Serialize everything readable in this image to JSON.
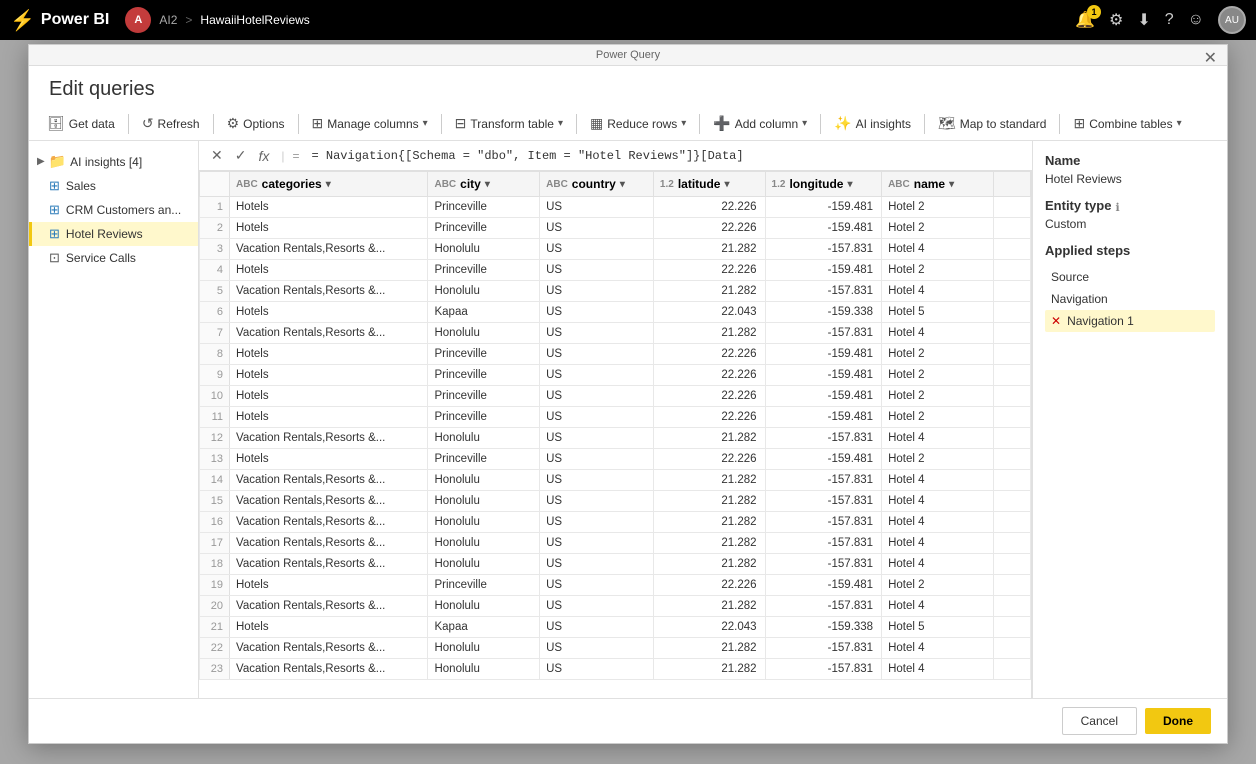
{
  "topbar": {
    "brand": "Power BI",
    "brand_icon": "⚡",
    "user_initials": "A",
    "ai2_label": "AI2",
    "breadcrumb_sep": ">",
    "breadcrumb_item": "HawaiiHotelReviews",
    "notification_count": "1",
    "icons": {
      "notification": "🔔",
      "settings": "⚙",
      "download": "⬇",
      "help": "?",
      "smiley": "☺"
    }
  },
  "modal": {
    "header_label": "Power Query",
    "page_title": "Edit queries",
    "close_icon": "✕"
  },
  "toolbar": {
    "get_data": "Get data",
    "refresh": "Refresh",
    "options": "Options",
    "manage_columns": "Manage columns",
    "transform_table": "Transform table",
    "reduce_rows": "Reduce rows",
    "add_column": "Add column",
    "ai_insights": "AI insights",
    "map_to_standard": "Map to standard",
    "combine_tables": "Combine tables"
  },
  "sidebar": {
    "group_label": "AI insights [4]",
    "items": [
      {
        "label": "Sales",
        "type": "table"
      },
      {
        "label": "CRM Customers an...",
        "type": "table"
      },
      {
        "label": "Hotel Reviews",
        "type": "table",
        "active": true
      },
      {
        "label": "Service Calls",
        "type": "service"
      }
    ]
  },
  "formula_bar": {
    "formula": "= Navigation{[Schema = \"dbo\", Item = \"Hotel Reviews\"]}[Data]"
  },
  "columns": [
    {
      "name": "categories",
      "type": "ABC"
    },
    {
      "name": "city",
      "type": "ABC"
    },
    {
      "name": "country",
      "type": "ABC"
    },
    {
      "name": "latitude",
      "type": "1.2"
    },
    {
      "name": "longitude",
      "type": "1.2"
    },
    {
      "name": "name",
      "type": "ABC"
    }
  ],
  "rows": [
    {
      "n": 1,
      "categories": "Hotels",
      "city": "Princeville",
      "country": "US",
      "latitude": "22.226",
      "longitude": "-159.481",
      "name": "Hotel 2"
    },
    {
      "n": 2,
      "categories": "Hotels",
      "city": "Princeville",
      "country": "US",
      "latitude": "22.226",
      "longitude": "-159.481",
      "name": "Hotel 2"
    },
    {
      "n": 3,
      "categories": "Vacation Rentals,Resorts &...",
      "city": "Honolulu",
      "country": "US",
      "latitude": "21.282",
      "longitude": "-157.831",
      "name": "Hotel 4"
    },
    {
      "n": 4,
      "categories": "Hotels",
      "city": "Princeville",
      "country": "US",
      "latitude": "22.226",
      "longitude": "-159.481",
      "name": "Hotel 2"
    },
    {
      "n": 5,
      "categories": "Vacation Rentals,Resorts &...",
      "city": "Honolulu",
      "country": "US",
      "latitude": "21.282",
      "longitude": "-157.831",
      "name": "Hotel 4"
    },
    {
      "n": 6,
      "categories": "Hotels",
      "city": "Kapaa",
      "country": "US",
      "latitude": "22.043",
      "longitude": "-159.338",
      "name": "Hotel 5"
    },
    {
      "n": 7,
      "categories": "Vacation Rentals,Resorts &...",
      "city": "Honolulu",
      "country": "US",
      "latitude": "21.282",
      "longitude": "-157.831",
      "name": "Hotel 4"
    },
    {
      "n": 8,
      "categories": "Hotels",
      "city": "Princeville",
      "country": "US",
      "latitude": "22.226",
      "longitude": "-159.481",
      "name": "Hotel 2"
    },
    {
      "n": 9,
      "categories": "Hotels",
      "city": "Princeville",
      "country": "US",
      "latitude": "22.226",
      "longitude": "-159.481",
      "name": "Hotel 2"
    },
    {
      "n": 10,
      "categories": "Hotels",
      "city": "Princeville",
      "country": "US",
      "latitude": "22.226",
      "longitude": "-159.481",
      "name": "Hotel 2"
    },
    {
      "n": 11,
      "categories": "Hotels",
      "city": "Princeville",
      "country": "US",
      "latitude": "22.226",
      "longitude": "-159.481",
      "name": "Hotel 2"
    },
    {
      "n": 12,
      "categories": "Vacation Rentals,Resorts &...",
      "city": "Honolulu",
      "country": "US",
      "latitude": "21.282",
      "longitude": "-157.831",
      "name": "Hotel 4"
    },
    {
      "n": 13,
      "categories": "Hotels",
      "city": "Princeville",
      "country": "US",
      "latitude": "22.226",
      "longitude": "-159.481",
      "name": "Hotel 2"
    },
    {
      "n": 14,
      "categories": "Vacation Rentals,Resorts &...",
      "city": "Honolulu",
      "country": "US",
      "latitude": "21.282",
      "longitude": "-157.831",
      "name": "Hotel 4"
    },
    {
      "n": 15,
      "categories": "Vacation Rentals,Resorts &...",
      "city": "Honolulu",
      "country": "US",
      "latitude": "21.282",
      "longitude": "-157.831",
      "name": "Hotel 4"
    },
    {
      "n": 16,
      "categories": "Vacation Rentals,Resorts &...",
      "city": "Honolulu",
      "country": "US",
      "latitude": "21.282",
      "longitude": "-157.831",
      "name": "Hotel 4"
    },
    {
      "n": 17,
      "categories": "Vacation Rentals,Resorts &...",
      "city": "Honolulu",
      "country": "US",
      "latitude": "21.282",
      "longitude": "-157.831",
      "name": "Hotel 4"
    },
    {
      "n": 18,
      "categories": "Vacation Rentals,Resorts &...",
      "city": "Honolulu",
      "country": "US",
      "latitude": "21.282",
      "longitude": "-157.831",
      "name": "Hotel 4"
    },
    {
      "n": 19,
      "categories": "Hotels",
      "city": "Princeville",
      "country": "US",
      "latitude": "22.226",
      "longitude": "-159.481",
      "name": "Hotel 2"
    },
    {
      "n": 20,
      "categories": "Vacation Rentals,Resorts &...",
      "city": "Honolulu",
      "country": "US",
      "latitude": "21.282",
      "longitude": "-157.831",
      "name": "Hotel 4"
    },
    {
      "n": 21,
      "categories": "Hotels",
      "city": "Kapaa",
      "country": "US",
      "latitude": "22.043",
      "longitude": "-159.338",
      "name": "Hotel 5"
    },
    {
      "n": 22,
      "categories": "Vacation Rentals,Resorts &...",
      "city": "Honolulu",
      "country": "US",
      "latitude": "21.282",
      "longitude": "-157.831",
      "name": "Hotel 4"
    },
    {
      "n": 23,
      "categories": "Vacation Rentals,Resorts &...",
      "city": "Honolulu",
      "country": "US",
      "latitude": "21.282",
      "longitude": "-157.831",
      "name": "Hotel 4"
    }
  ],
  "properties": {
    "name_label": "Name",
    "name_value": "Hotel Reviews",
    "entity_type_label": "Entity type",
    "entity_info": "ℹ",
    "entity_value": "Custom",
    "applied_steps_label": "Applied steps",
    "steps": [
      {
        "label": "Source",
        "active": false,
        "deletable": false
      },
      {
        "label": "Navigation",
        "active": false,
        "deletable": false
      },
      {
        "label": "Navigation 1",
        "active": true,
        "deletable": true
      }
    ]
  },
  "footer": {
    "cancel_label": "Cancel",
    "done_label": "Done"
  }
}
